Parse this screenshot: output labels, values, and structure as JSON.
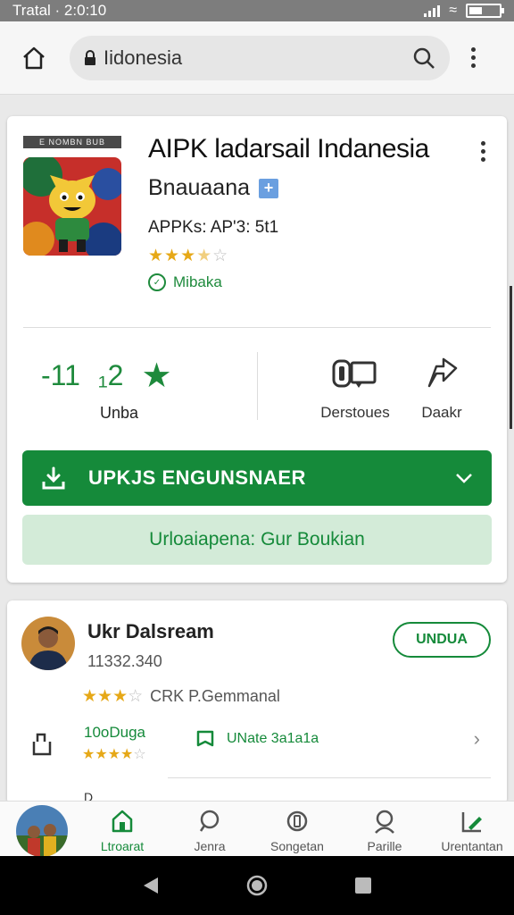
{
  "status_bar": {
    "carrier_time": "Tratal · 2:0:10"
  },
  "browser": {
    "url": "Iidonesia"
  },
  "app": {
    "tag": "E NOMBN BUB",
    "title": "AIPK ladarsail Indanesia",
    "developer": "Bnauaana",
    "meta": "APPKs: AP'3: 5t1",
    "rating_stars": 3,
    "verified_label": "Mibaka",
    "stats": {
      "left_value": "-11",
      "mid_value": "₁2",
      "label": "Unba"
    },
    "actions": [
      {
        "label": "Derstoues",
        "icon": "devices-icon"
      },
      {
        "label": "Daakr",
        "icon": "share-icon"
      }
    ],
    "install_label": "UPKJS ENGUNSNAER",
    "secondary_label": "Urloaiapena: Gur Boukian"
  },
  "review": {
    "reviewer": "Ukr Dalsream",
    "sub": "11332.340",
    "button": "UNDUA",
    "rating_stars": 3,
    "rating_text": "CRK P.Gemmanal",
    "left_label": "10oDuga",
    "mid_label": "UNate 3a1a1a",
    "peek": "D_____"
  },
  "bottom_nav": [
    {
      "label": "Ltroarat",
      "active": true
    },
    {
      "label": "Jenra",
      "active": false
    },
    {
      "label": "Songetan",
      "active": false
    },
    {
      "label": "Parille",
      "active": false
    },
    {
      "label": "Urentantan",
      "active": false
    }
  ],
  "colors": {
    "primary": "#158a3a",
    "star": "#e6a817",
    "status_bar": "#7d7d7d"
  }
}
